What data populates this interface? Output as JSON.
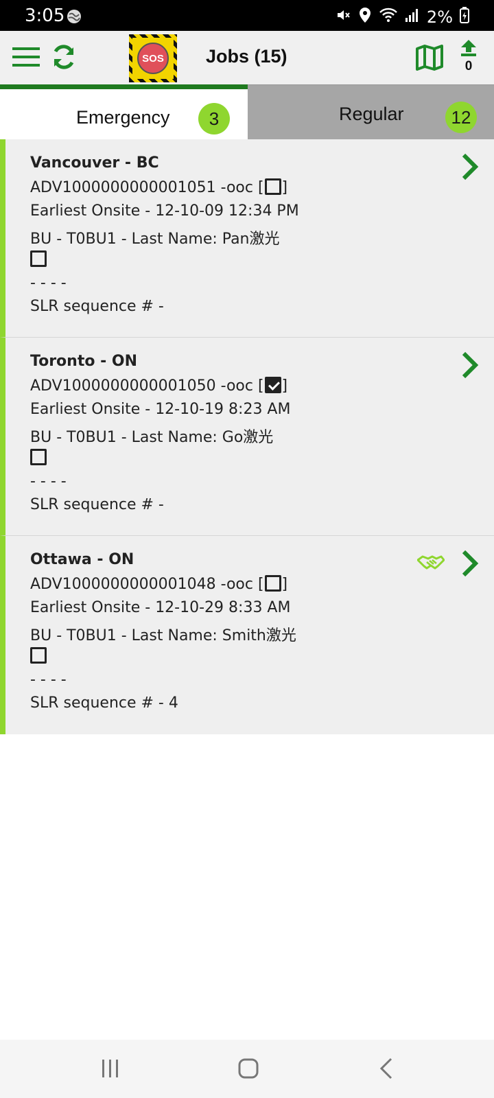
{
  "status_bar": {
    "time": "3:05",
    "battery": "2%",
    "icons": [
      "globe-icon",
      "mute-icon",
      "location-icon",
      "wifi-icon",
      "signal-icon",
      "battery-icon"
    ]
  },
  "header": {
    "title": "Jobs (15)",
    "sos_label": "SOS",
    "upload_count": "0",
    "icons": [
      "hamburger-icon",
      "refresh-icon",
      "map-icon",
      "upload-icon"
    ]
  },
  "tabs": [
    {
      "label": "Emergency",
      "count": "3",
      "selected": true
    },
    {
      "label": "Regular",
      "count": "12",
      "selected": false
    }
  ],
  "jobs": [
    {
      "title": "Vancouver - BC",
      "id_text": "ADV1000000000001051 -ooc [",
      "id_suffix": "]",
      "ooc_checked": false,
      "onsite": "Earliest Onsite - 12-10-09 12:34 PM",
      "bu": "BU - T0BU1 - Last Name: Pan激光",
      "dashes": "- - - -",
      "slr": "SLR sequence # -",
      "handshake": false
    },
    {
      "title": "Toronto - ON",
      "id_text": "ADV1000000000001050 -ooc [",
      "id_suffix": "]",
      "ooc_checked": true,
      "onsite": "Earliest Onsite - 12-10-19 8:23 AM",
      "bu": "BU - T0BU1 - Last Name: Go激光",
      "dashes": "- - - -",
      "slr": "SLR sequence # -",
      "handshake": false
    },
    {
      "title": "Ottawa - ON",
      "id_text": "ADV1000000000001048 -ooc [",
      "id_suffix": "]",
      "ooc_checked": false,
      "onsite": "Earliest Onsite - 12-10-29 8:33 AM",
      "bu": "BU - T0BU1 - Last Name: Smith激光",
      "dashes": "- - - -",
      "slr": "SLR sequence # - 4",
      "handshake": true
    }
  ],
  "colors": {
    "accent_green": "#1f7a1f",
    "badge_green": "#8fd62f",
    "sos_red": "#e0505a",
    "sos_yellow": "#f2d400"
  },
  "nav_bar": {
    "icons": [
      "recent-apps-icon",
      "home-icon",
      "back-icon"
    ]
  }
}
